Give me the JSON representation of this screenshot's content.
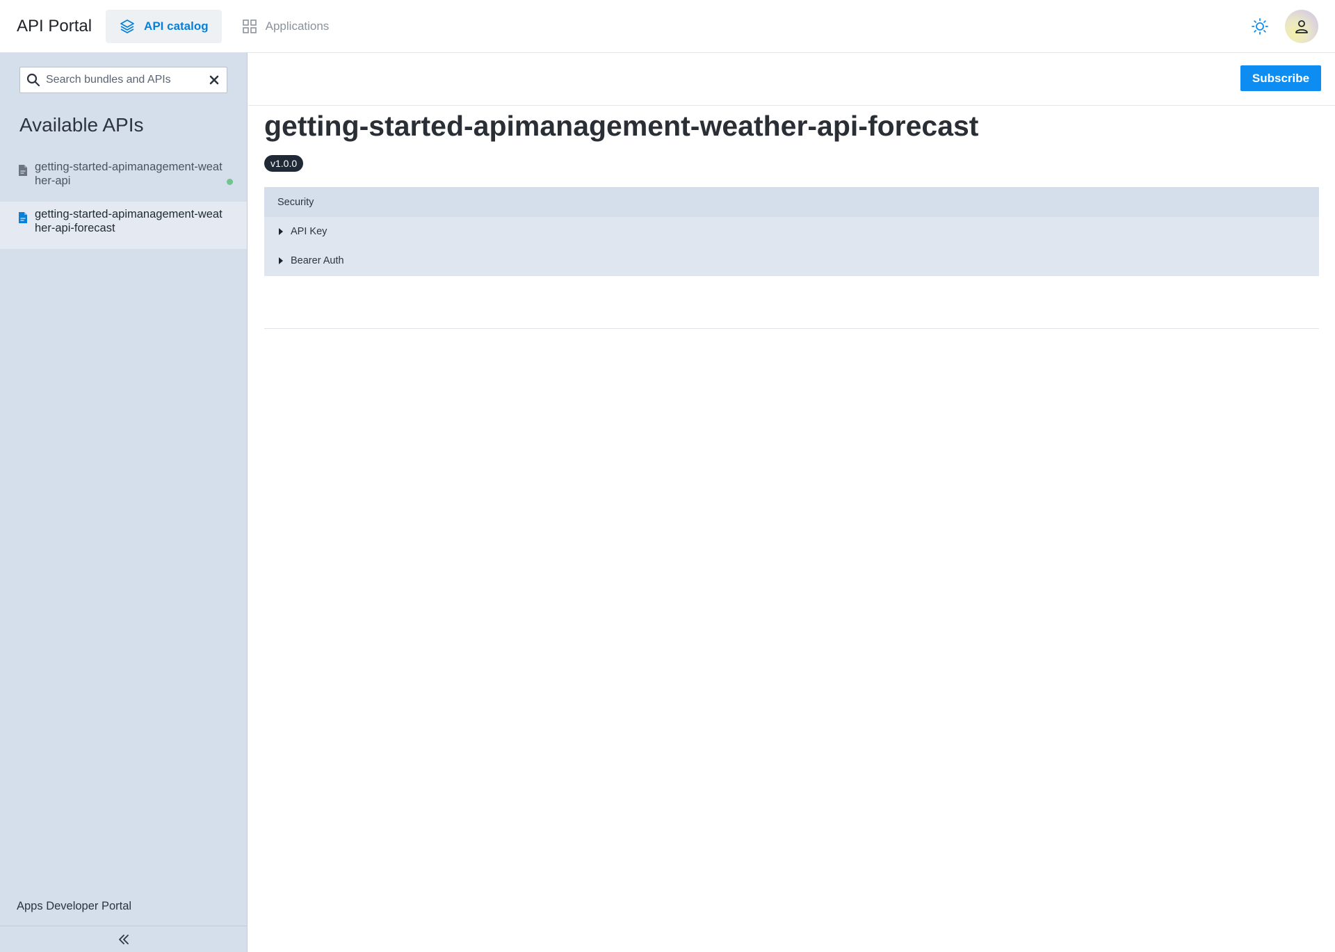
{
  "header": {
    "brand": "API Portal",
    "tabs": [
      {
        "label": "API catalog",
        "active": true,
        "icon": "layers-icon"
      },
      {
        "label": "Applications",
        "active": false,
        "icon": "grid-icon"
      }
    ],
    "theme_icon": "sun-icon",
    "avatar_icon": "user-icon"
  },
  "sidebar": {
    "search": {
      "placeholder": "Search bundles and APIs",
      "value": ""
    },
    "heading": "Available APIs",
    "items": [
      {
        "label": "getting-started-apimanagement-weather-api",
        "selected": false,
        "status": "active"
      },
      {
        "label": "getting-started-apimanagement-weather-api-forecast",
        "selected": true
      }
    ],
    "footer": "Apps Developer Portal",
    "collapse_icon": "double-chevron-left-icon"
  },
  "main": {
    "subscribe_label": "Subscribe",
    "title": "getting-started-apimanagement-weather-api-forecast",
    "version": "v1.0.0",
    "security": {
      "header": "Security",
      "schemes": [
        "API Key",
        "Bearer Auth"
      ]
    }
  },
  "colors": {
    "accent": "#0d8df2",
    "active_tab_text": "#0a7fd6",
    "sidebar_bg": "#d5deeb",
    "status_dot": "#72c48f",
    "badge_bg": "#1f2a36"
  }
}
